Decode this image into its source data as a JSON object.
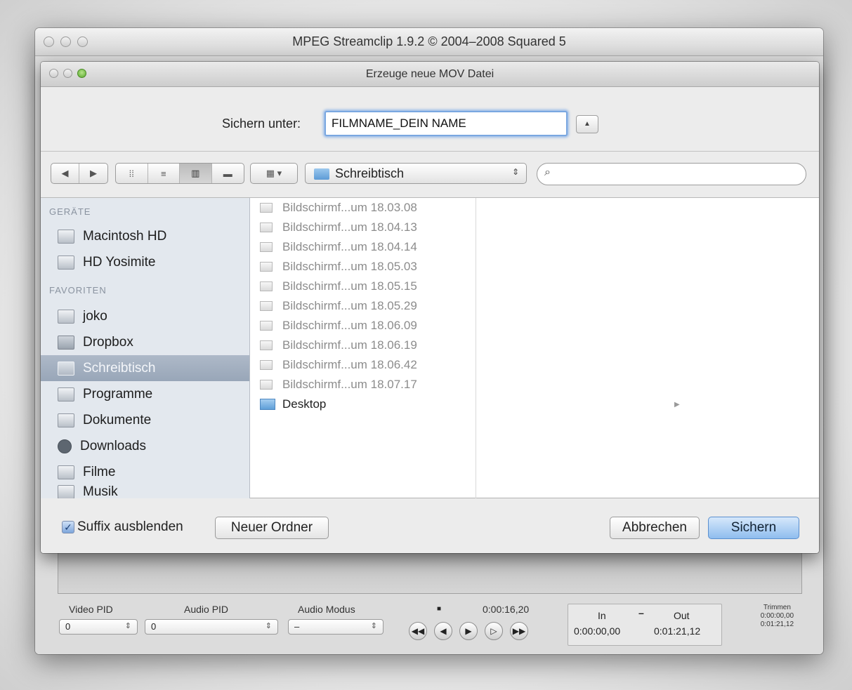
{
  "main_window": {
    "title": "MPEG Streamclip 1.9.2 © 2004–2008 Squared 5",
    "controls": {
      "video_pid_label": "Video PID",
      "video_pid_value": "0",
      "audio_pid_label": "Audio PID",
      "audio_pid_value": "0",
      "audio_mode_label": "Audio Modus",
      "audio_mode_value": "–",
      "timecode": "0:00:16,20",
      "in_label": "In",
      "dash": "–",
      "out_label": "Out",
      "in_value": "0:00:00,00",
      "out_value": "0:01:21,12",
      "trim_label": "Trimmen",
      "trim_in": "0:00:00,00",
      "trim_out": "0:01:21,12"
    }
  },
  "sheet": {
    "title": "Erzeuge neue MOV Datei",
    "save_as_label": "Sichern unter:",
    "filename_value": "FILMNAME_DEIN NAME",
    "location": "Schreibtisch",
    "search_placeholder": "",
    "sidebar": {
      "devices_header": "GERÄTE",
      "devices": [
        {
          "label": "Macintosh HD"
        },
        {
          "label": "HD Yosimite"
        }
      ],
      "favorites_header": "FAVORITEN",
      "favorites": [
        {
          "label": "joko"
        },
        {
          "label": "Dropbox"
        },
        {
          "label": "Schreibtisch"
        },
        {
          "label": "Programme"
        },
        {
          "label": "Dokumente"
        },
        {
          "label": "Downloads"
        },
        {
          "label": "Filme"
        },
        {
          "label": "Musik"
        }
      ]
    },
    "files": [
      "Bildschirmf...um 18.03.08",
      "Bildschirmf...um 18.04.13",
      "Bildschirmf...um 18.04.14",
      "Bildschirmf...um 18.05.03",
      "Bildschirmf...um 18.05.15",
      "Bildschirmf...um 18.05.29",
      "Bildschirmf...um 18.06.09",
      "Bildschirmf...um 18.06.19",
      "Bildschirmf...um 18.06.42",
      "Bildschirmf...um 18.07.17"
    ],
    "folder_item": "Desktop",
    "hide_extension_label": "Suffix ausblenden",
    "new_folder_label": "Neuer Ordner",
    "cancel_label": "Abbrechen",
    "save_label": "Sichern"
  },
  "icons": {
    "back": "◀",
    "forward": "▶",
    "icon_view": "⁞⁞",
    "list_view": "≡",
    "column_view": "▥",
    "coverflow_view": "▬",
    "arrange": "▦ ▾",
    "search": "⌕",
    "expand": "▲",
    "updown": "⇕",
    "check": "✓",
    "rewind": "◀◀",
    "step_back": "◀",
    "play": "▶",
    "step_forward": "▷",
    "fast_forward": "▶▶",
    "stop": "■"
  },
  "colors": {
    "accent": "#7aa7e0",
    "sidebar_selected": "#a3b0c1",
    "sidebar_bg": "#e3e8ee"
  }
}
